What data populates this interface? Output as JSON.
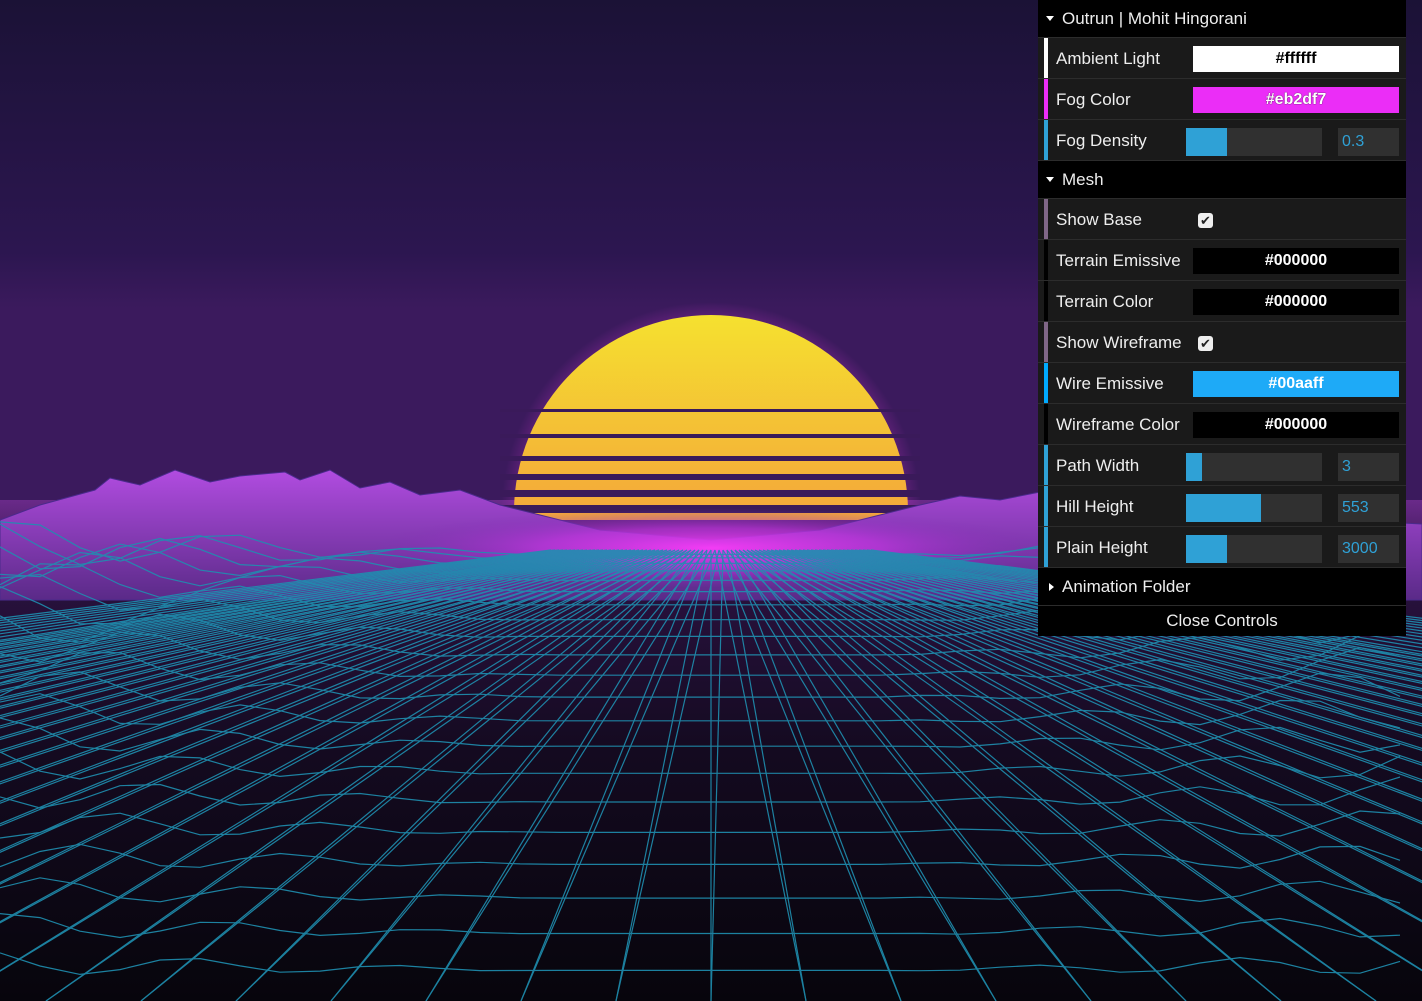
{
  "gui": {
    "title": "Outrun | Mohit Hingorani",
    "root_controls": [
      {
        "label": "Ambient Light",
        "type": "color",
        "value": "#ffffff",
        "text_color": "#000000",
        "accent": "#ffffff"
      },
      {
        "label": "Fog Color",
        "type": "color",
        "value": "#eb2df7",
        "text_color": "#ffffff",
        "accent": "#eb2df7"
      },
      {
        "label": "Fog Density",
        "type": "slider",
        "value": "0.3",
        "fraction": 0.3,
        "accent": "#2fa1d6"
      }
    ],
    "mesh_folder": {
      "title": "Mesh",
      "controls": [
        {
          "label": "Show Base",
          "type": "checkbox",
          "checked": true,
          "accent": "#806787"
        },
        {
          "label": "Terrain Emissive",
          "type": "color",
          "value": "#000000",
          "text_color": "#ffffff",
          "accent": "#000000"
        },
        {
          "label": "Terrain Color",
          "type": "color",
          "value": "#000000",
          "text_color": "#ffffff",
          "accent": "#000000"
        },
        {
          "label": "Show Wireframe",
          "type": "checkbox",
          "checked": true,
          "accent": "#806787"
        },
        {
          "label": "Wire Emissive",
          "type": "color",
          "value": "#00aaff",
          "text_color": "#ffffff",
          "accent": "#00aaff"
        },
        {
          "label": "Wireframe Color",
          "type": "color",
          "value": "#000000",
          "text_color": "#ffffff",
          "accent": "#000000"
        },
        {
          "label": "Path Width",
          "type": "slider",
          "value": "3",
          "fraction": 0.12,
          "accent": "#2fa1d6"
        },
        {
          "label": "Hill Height",
          "type": "slider",
          "value": "553",
          "fraction": 0.55,
          "accent": "#2fa1d6"
        },
        {
          "label": "Plain Height",
          "type": "slider",
          "value": "3000",
          "fraction": 0.3,
          "accent": "#2fa1d6"
        }
      ]
    },
    "animation_folder": {
      "title": "Animation Folder"
    },
    "close_label": "Close Controls"
  },
  "scene": {
    "sky_top": "#1d1238",
    "sky_bottom": "#3a1a5a",
    "sun_top": "#f6e12e",
    "sun_bottom": "#f0574e",
    "mountain_color": "#a93ed6",
    "horizon_glow": "#eb2df7",
    "grid_color": "#1f8fb0"
  }
}
